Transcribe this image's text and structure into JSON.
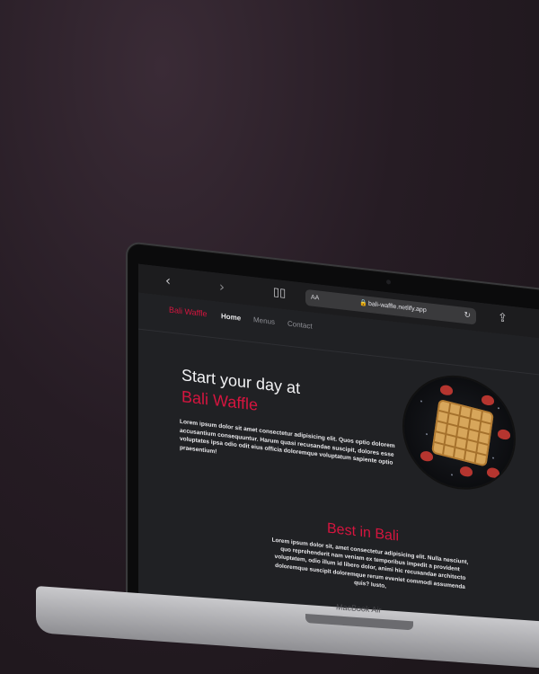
{
  "device": {
    "model": "MacBook Air"
  },
  "browser": {
    "text_size": "AA",
    "url": "bali-waffle.netlify.app",
    "icons": [
      "back-icon",
      "forward-icon",
      "reader-icon",
      "lock-icon",
      "reload-icon",
      "share-icon"
    ]
  },
  "site": {
    "brand": "Bali Waffle",
    "nav": [
      "Home",
      "Menus",
      "Contact"
    ],
    "hero": {
      "title": "Start your day at",
      "brand": "Bali Waffle",
      "text": "Lorem ipsum dolor sit amet consectetur adipisicing elit. Quos optio dolorem accusantium consequuntur. Harum quasi recusandae suscipit, dolores esse voluptates ipsa odio odit eius officia doloremque voluptatum sapiente optio praesentium!"
    },
    "section": {
      "title": "Best in Bali",
      "text": "Lorem ipsum dolor sit, amet consectetur adipisicing elit. Nulla nesciunt, quo reprehenderit nam veniam ex temporibus impedit a provident voluptatem, odio illum id libero dolor, animi hic recusandae architecto doloremque suscipit doloremque rerum eveniet commodi assumenda quis? Iusto,"
    }
  },
  "colors": {
    "accent": "#d6153f",
    "page_bg": "#202124"
  }
}
